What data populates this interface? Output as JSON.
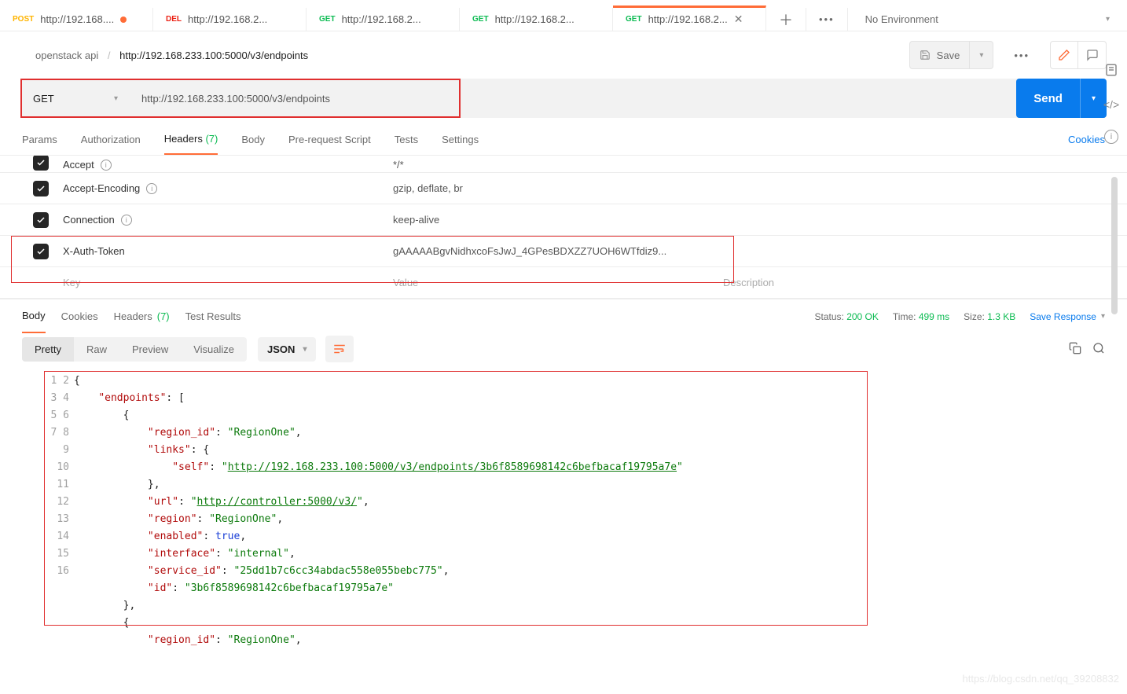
{
  "tabs": [
    {
      "method": "POST",
      "methodClass": "method-post",
      "title": "http://192.168....",
      "dirty": true
    },
    {
      "method": "DEL",
      "methodClass": "method-del",
      "title": "http://192.168.2..."
    },
    {
      "method": "GET",
      "methodClass": "method-get",
      "title": "http://192.168.2..."
    },
    {
      "method": "GET",
      "methodClass": "method-get",
      "title": "http://192.168.2..."
    },
    {
      "method": "GET",
      "methodClass": "method-get",
      "title": "http://192.168.2...",
      "active": true,
      "closable": true
    }
  ],
  "env": {
    "label": "No Environment"
  },
  "breadcrumb": {
    "collection": "openstack api",
    "current": "http://192.168.233.100:5000/v3/endpoints"
  },
  "toolbar": {
    "save": "Save"
  },
  "request": {
    "method": "GET",
    "url": "http://192.168.233.100:5000/v3/endpoints",
    "send": "Send",
    "subtabs": [
      "Params",
      "Authorization",
      "Headers",
      "Body",
      "Pre-request Script",
      "Tests",
      "Settings"
    ],
    "headers_count": "(7)",
    "cookies_link": "Cookies"
  },
  "headers": [
    {
      "key": "Accept",
      "info": true,
      "value": "*/*"
    },
    {
      "key": "Accept-Encoding",
      "info": true,
      "value": "gzip, deflate, br"
    },
    {
      "key": "Connection",
      "info": true,
      "value": "keep-alive"
    },
    {
      "key": "X-Auth-Token",
      "info": false,
      "value": "gAAAAABgvNidhxcoFsJwJ_4GPesBDXZZ7UOH6WTfdiz9..."
    }
  ],
  "header_placeholders": {
    "key": "Key",
    "value": "Value",
    "desc": "Description"
  },
  "response": {
    "tabs": [
      "Body",
      "Cookies",
      "Headers",
      "Test Results"
    ],
    "headers_count": "(7)",
    "status_label": "Status:",
    "status_value": "200 OK",
    "time_label": "Time:",
    "time_value": "499 ms",
    "size_label": "Size:",
    "size_value": "1.3 KB",
    "save": "Save Response",
    "views": [
      "Pretty",
      "Raw",
      "Preview",
      "Visualize"
    ],
    "format": "JSON"
  },
  "json_body": {
    "endpoints": [
      {
        "region_id": "RegionOne",
        "links": {
          "self": "http://192.168.233.100:5000/v3/endpoints/3b6f8589698142c6befbacaf19795a7e"
        },
        "url": "http://controller:5000/v3/",
        "region": "RegionOne",
        "enabled": true,
        "interface": "internal",
        "service_id": "25dd1b7c6cc34abdac558e055bebc775",
        "id": "3b6f8589698142c6befbacaf19795a7e"
      },
      {
        "region_id": "RegionOne"
      }
    ]
  },
  "watermark": "https://blog.csdn.net/qq_39208832"
}
